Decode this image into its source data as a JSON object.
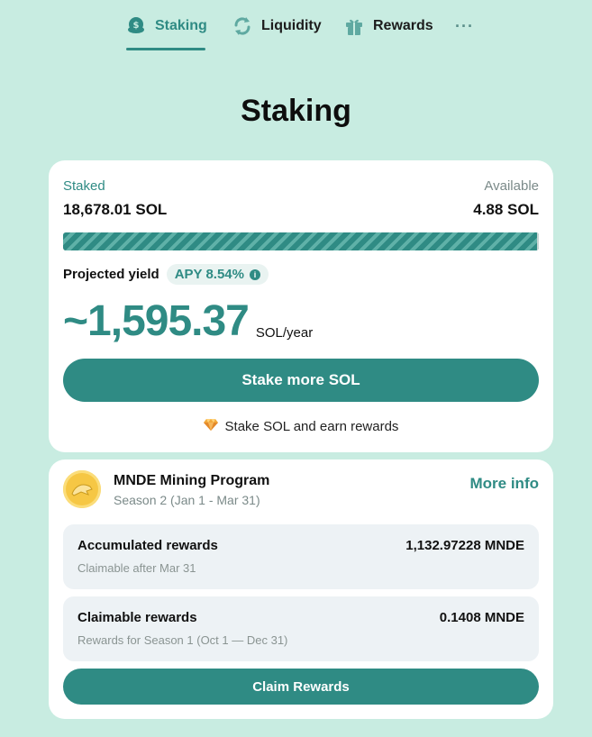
{
  "nav": {
    "tabs": [
      {
        "label": "Staking",
        "icon": "coin-stack-icon",
        "active": true
      },
      {
        "label": "Liquidity",
        "icon": "swap-arrows-icon",
        "active": false
      },
      {
        "label": "Rewards",
        "icon": "gift-icon",
        "active": false
      }
    ],
    "more": "···"
  },
  "page_title": "Staking",
  "staking_card": {
    "staked_label": "Staked",
    "staked_value": "18,678.01 SOL",
    "available_label": "Available",
    "available_value": "4.88 SOL",
    "staked_fraction": 0.9997,
    "projected_yield_label": "Projected yield",
    "apy_label": "APY 8.54%",
    "projected_amount": "~1,595.37",
    "projected_unit": "SOL/year",
    "stake_button": "Stake more SOL",
    "footer_note": "Stake SOL and earn rewards"
  },
  "mining_card": {
    "title": "MNDE Mining Program",
    "subtitle": "Season 2 (Jan 1 - Mar 31)",
    "more_info": "More info",
    "accumulated": {
      "title": "Accumulated rewards",
      "value": "1,132.97228 MNDE",
      "sub": "Claimable after Mar 31"
    },
    "claimable": {
      "title": "Claimable rewards",
      "value": "0.1408 MNDE",
      "sub": "Rewards for Season 1 (Oct 1 — Dec 31)"
    },
    "claim_button": "Claim Rewards"
  },
  "colors": {
    "background": "#c8ece1",
    "accent": "#2f8b84",
    "card": "#ffffff",
    "muted": "#7b8a89"
  }
}
